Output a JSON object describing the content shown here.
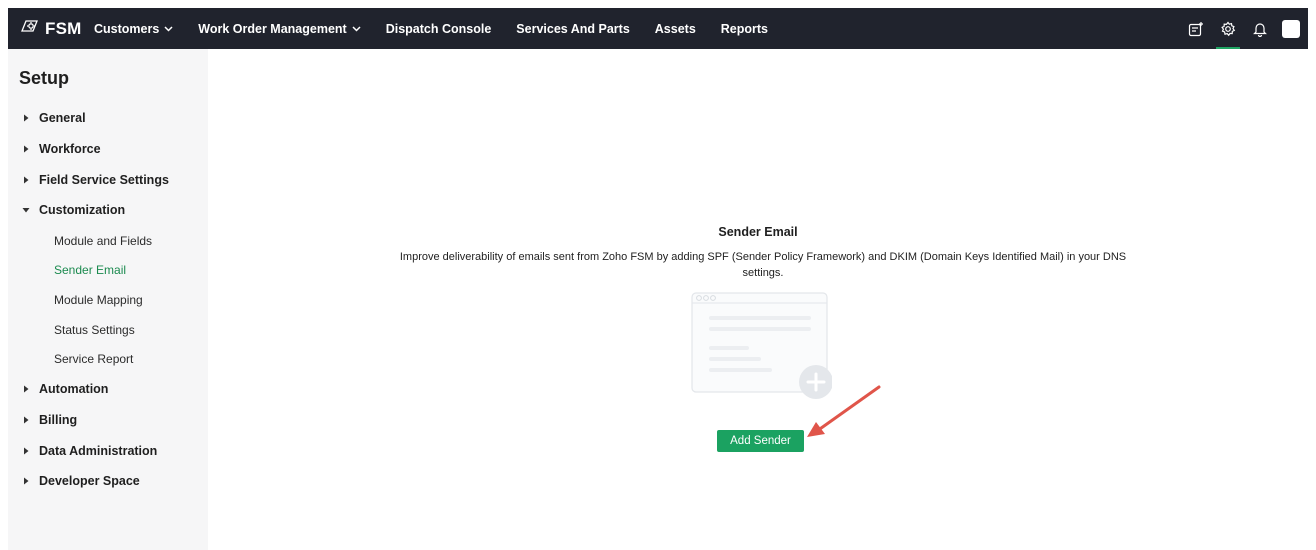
{
  "app": {
    "brand": "FSM"
  },
  "nav": [
    {
      "label": "Customers",
      "has_menu": true
    },
    {
      "label": "Work Order Management",
      "has_menu": true
    },
    {
      "label": "Dispatch Console",
      "has_menu": false
    },
    {
      "label": "Services And Parts",
      "has_menu": false
    },
    {
      "label": "Assets",
      "has_menu": false
    },
    {
      "label": "Reports",
      "has_menu": false
    }
  ],
  "header_icons": [
    "new-note-icon",
    "gear-icon",
    "bell-icon",
    "avatar"
  ],
  "sidebar": {
    "title": "Setup",
    "items": [
      {
        "label": "General",
        "expanded": false
      },
      {
        "label": "Workforce",
        "expanded": false
      },
      {
        "label": "Field Service Settings",
        "expanded": false
      },
      {
        "label": "Customization",
        "expanded": true,
        "children": [
          {
            "label": "Module and Fields"
          },
          {
            "label": "Sender Email",
            "active": true
          },
          {
            "label": "Module Mapping"
          },
          {
            "label": "Status Settings"
          },
          {
            "label": "Service Report"
          }
        ]
      },
      {
        "label": "Automation",
        "expanded": false
      },
      {
        "label": "Billing",
        "expanded": false
      },
      {
        "label": "Data Administration",
        "expanded": false
      },
      {
        "label": "Developer Space",
        "expanded": false
      }
    ]
  },
  "main": {
    "heading": "Sender Email",
    "description": "Improve deliverability of emails sent from Zoho FSM by adding SPF (Sender Policy Framework) and DKIM (Domain Keys Identified Mail) in your DNS settings.",
    "button_label": "Add Sender"
  },
  "colors": {
    "topbar": "#20232d",
    "accent": "#1ba261",
    "active_link": "#1b8a4f",
    "sidebar_bg": "#f6f6f7",
    "annotation_arrow": "#e0554a"
  }
}
